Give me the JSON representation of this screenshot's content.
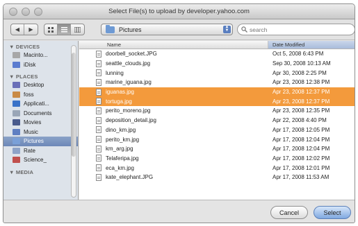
{
  "window": {
    "title": "Select File(s) to upload by developer.yahoo.com"
  },
  "toolbar": {
    "nav_back": "◀",
    "nav_forward": "▶",
    "location": "Pictures",
    "search_placeholder": "search"
  },
  "sidebar": {
    "devices_label": "▼ DEVICES",
    "places_label": "▼ PLACES",
    "media_label": "▼ MEDIA",
    "devices": [
      {
        "label": "Macinto...",
        "color": "#a7a7a7"
      },
      {
        "label": "iDisk",
        "color": "#5b7ccf"
      }
    ],
    "places": [
      {
        "label": "Desktop",
        "color": "#6a6fb8"
      },
      {
        "label": "foss",
        "color": "#c98a45"
      },
      {
        "label": "Applicati...",
        "color": "#3a73c8"
      },
      {
        "label": "Documents",
        "color": "#9aa6b7"
      },
      {
        "label": "Movies",
        "color": "#4a5b8c"
      },
      {
        "label": "Music",
        "color": "#5f7fc2"
      },
      {
        "label": "Pictures",
        "color": "#7aa0d8"
      },
      {
        "label": "Rate",
        "color": "#8ea3c8"
      },
      {
        "label": "Science_",
        "color": "#c0504d"
      }
    ]
  },
  "filelist": {
    "header_name": "Name",
    "header_date": "Date Modified",
    "rows": [
      {
        "name": "doorbell_socket.JPG",
        "date": "Oct 5, 2008 6:43 PM"
      },
      {
        "name": "seattle_clouds.jpg",
        "date": "Sep 30, 2008 10:13 AM"
      },
      {
        "name": "lunning",
        "date": "Apr 30, 2008 2:25 PM"
      },
      {
        "name": "marine_iguana.jpg",
        "date": "Apr 23, 2008 12:38 PM"
      },
      {
        "name": "iguanas.jpg",
        "date": "Apr 23, 2008 12:37 PM",
        "selected": true
      },
      {
        "name": "tortuga.jpg",
        "date": "Apr 23, 2008 12:37 PM",
        "selected": true
      },
      {
        "name": "perito_moreno.jpg",
        "date": "Apr 23, 2008 12:35 PM"
      },
      {
        "name": "deposition_detail.jpg",
        "date": "Apr 22, 2008 4:40 PM"
      },
      {
        "name": "dino_km.jpg",
        "date": "Apr 17, 2008 12:05 PM"
      },
      {
        "name": "perito_km.jpg",
        "date": "Apr 17, 2008 12:04 PM"
      },
      {
        "name": "km_arg.jpg",
        "date": "Apr 17, 2008 12:04 PM"
      },
      {
        "name": "Telaferipa.jpg",
        "date": "Apr 17, 2008 12:02 PM"
      },
      {
        "name": "eca_km.jpg",
        "date": "Apr 17, 2008 12:01 PM"
      },
      {
        "name": "kate_elephant.JPG",
        "date": "Apr 17, 2008 11:53 AM"
      },
      {
        "name": "",
        "date": ""
      }
    ]
  },
  "buttons": {
    "cancel": "Cancel",
    "select": "Select"
  }
}
